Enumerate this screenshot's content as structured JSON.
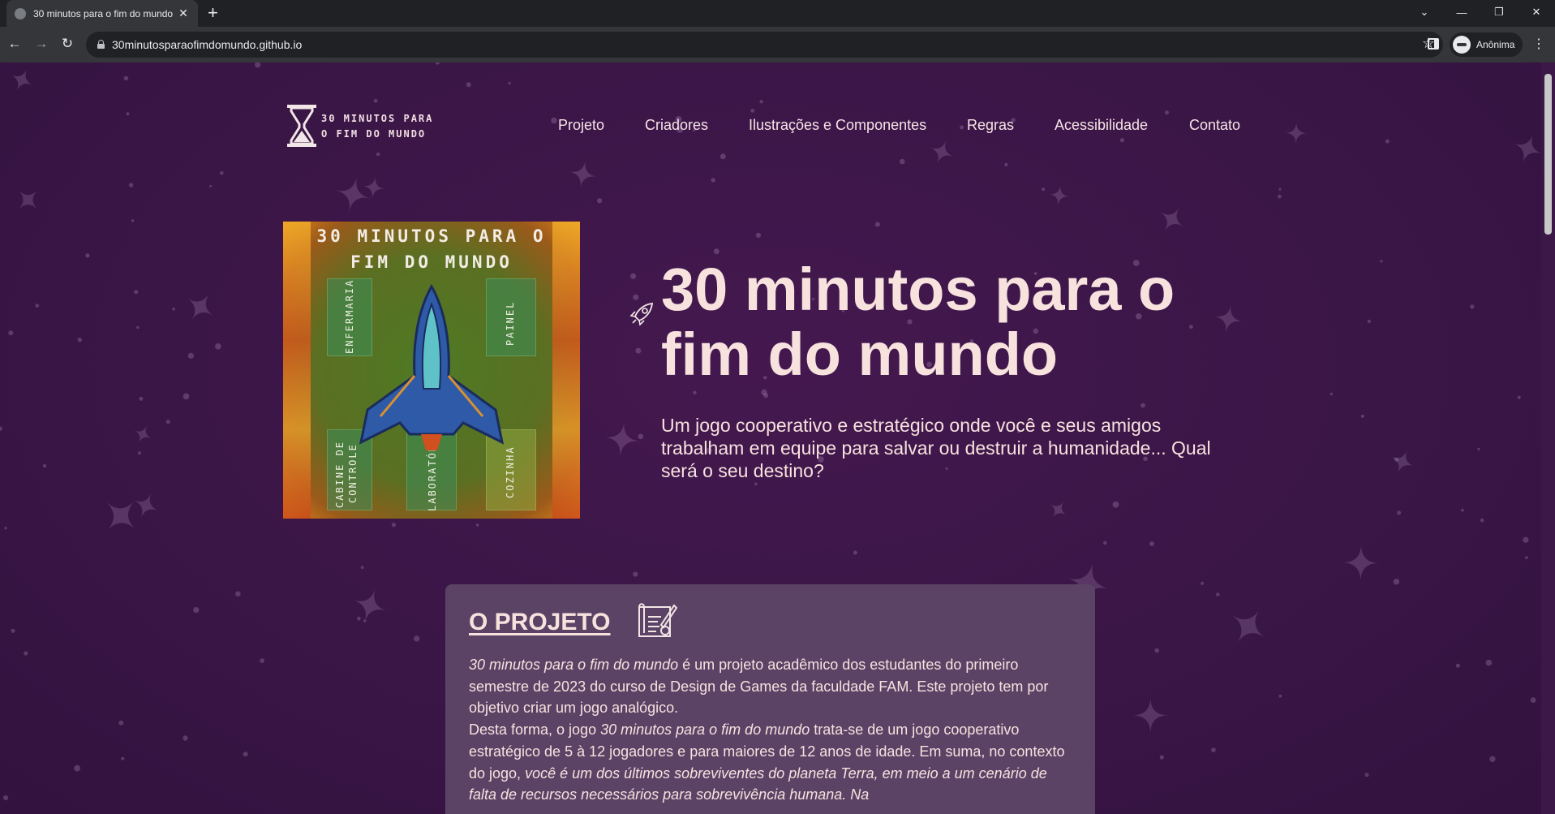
{
  "browser": {
    "tab_title": "30 minutos para o fim do mundo",
    "new_tab": "+",
    "tab_close": "✕",
    "url": "30minutosparaofimdomundo.github.io",
    "profile_label": "Anônima",
    "controls": {
      "tab_search": "⌄",
      "minimize": "—",
      "restore": "❐",
      "close": "✕",
      "back": "←",
      "forward": "→",
      "reload": "↻",
      "star": "☆",
      "menu": "⋮"
    }
  },
  "site": {
    "logo_line1": "30 MINUTOS PARA",
    "logo_line2": "O FIM DO MUNDO",
    "nav": [
      "Projeto",
      "Criadores",
      "Ilustrações e Componentes",
      "Regras",
      "Acessibilidade",
      "Contato"
    ],
    "card": {
      "title_line1": "30 MINUTOS PARA O",
      "title_line2": "FIM DO MUNDO",
      "rooms": [
        "ENFERMARIA",
        "PAINEL",
        "CABINE DE",
        "CONTROLE",
        "LABORATÓRIO",
        "COZINHA"
      ]
    },
    "hero_title": "30 minutos para o fim do mundo",
    "hero_subtitle": "Um jogo cooperativo e estratégico onde você e seus amigos trabalham em equipe para salvar ou destruir a humanidade... Qual será o seu destino?",
    "project": {
      "heading": "O PROJETO",
      "p1_italic": "30 minutos para o fim do mundo",
      "p1_rest": " é um projeto acadêmico dos estudantes do primeiro semestre de 2023 do curso de Design de Games da faculdade FAM. Este projeto tem por objetivo criar um jogo analógico.",
      "p2_start": "Desta forma, o jogo ",
      "p2_italic": "30 minutos para o fim do mundo",
      "p2_mid": " trata-se de um jogo cooperativo estratégico de 5 à 12 jogadores e para maiores de 12 anos de idade. Em suma, no contexto do jogo, ",
      "p2_italic2": "você é um dos últimos sobreviventes do planeta Terra, em meio a um cenário de falta de recursos necessários para sobrevivência humana. Na"
    }
  },
  "colors": {
    "page_bg": "#3a1646",
    "text": "#f7e2de",
    "card_bg": "#5b4366"
  }
}
